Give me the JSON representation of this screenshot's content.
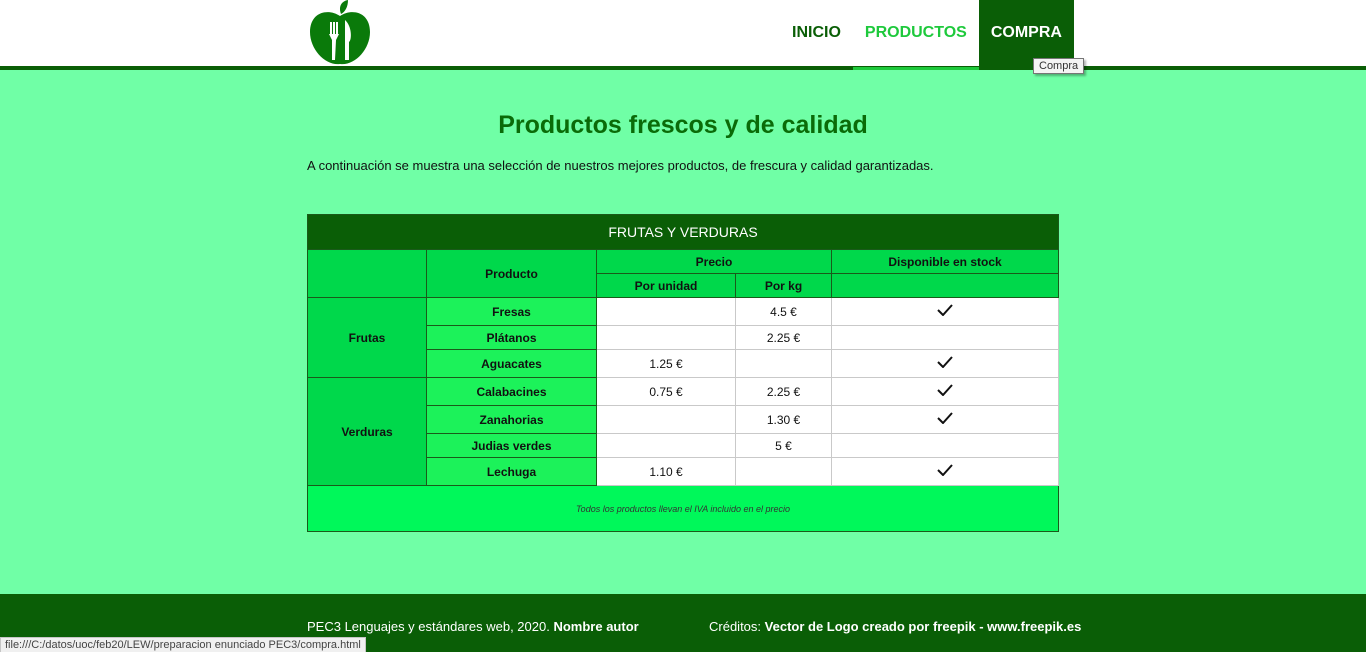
{
  "nav": {
    "items": [
      "INICIO",
      "PRODUCTOS",
      "COMPRA"
    ]
  },
  "tooltip": "Compra",
  "heading": "Productos frescos y de calidad",
  "intro": "A continuación se muestra una selección de nuestros mejores productos, de frescura y calidad garantizadas.",
  "table": {
    "caption": "FRUTAS Y VERDURAS",
    "headers": {
      "producto": "Producto",
      "precio": "Precio",
      "stock": "Disponible en stock",
      "unidad": "Por unidad",
      "kg": "Por kg"
    },
    "categories": {
      "frutas": "Frutas",
      "verduras": "Verduras"
    },
    "rows": [
      {
        "name": "Fresas",
        "unit": "",
        "kg": "4.5 €",
        "stock": true
      },
      {
        "name": "Plátanos",
        "unit": "",
        "kg": "2.25 €",
        "stock": false
      },
      {
        "name": "Aguacates",
        "unit": "1.25 €",
        "kg": "",
        "stock": true
      },
      {
        "name": "Calabacines",
        "unit": "0.75 €",
        "kg": "2.25 €",
        "stock": true
      },
      {
        "name": "Zanahorias",
        "unit": "",
        "kg": "1.30 €",
        "stock": true
      },
      {
        "name": "Judias verdes",
        "unit": "",
        "kg": "5 €",
        "stock": false
      },
      {
        "name": "Lechuga",
        "unit": "1.10 €",
        "kg": "",
        "stock": true
      }
    ],
    "footnote": "Todos los productos llevan el IVA incluido en el precio"
  },
  "footer": {
    "left_text": "PEC3 Lenguajes y estándares web, 2020.",
    "author": "Nombre autor",
    "credits_label": "Créditos:",
    "credits_text": "Vector de Logo creado por freepik - www.freepik.es"
  },
  "status_bar": "file:///C:/datos/uoc/feb20/LEW/preparacion enunciado PEC3/compra.html",
  "colors": {
    "brand_dark": "#0a5e06",
    "brand_light": "#1ec93c",
    "page_bg": "#70ffa6"
  }
}
